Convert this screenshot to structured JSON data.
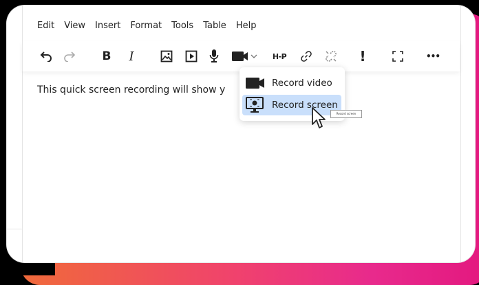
{
  "menubar": {
    "items": [
      "Edit",
      "View",
      "Insert",
      "Format",
      "Tools",
      "Table",
      "Help"
    ]
  },
  "toolbar": {
    "bold_label": "B",
    "italic_label": "I",
    "h5p_label": "H-P",
    "alert_label": "!",
    "more_label": "•••",
    "icons": [
      "undo-icon",
      "redo-icon",
      "bold-icon",
      "italic-icon",
      "image-icon",
      "media-icon",
      "microphone-icon",
      "video-camera-icon",
      "h5p-icon",
      "link-icon",
      "unlink-icon",
      "accessibility-icon",
      "fullscreen-icon",
      "more-icon"
    ]
  },
  "content": {
    "text": "This quick screen recording will show y"
  },
  "dropdown": {
    "items": [
      {
        "label": "Record video",
        "icon": "video-camera-icon",
        "highlighted": false
      },
      {
        "label": "Record screen",
        "icon": "monitor-record-icon",
        "highlighted": true
      }
    ]
  },
  "tooltip": {
    "text": "Record screen"
  },
  "colors": {
    "highlight": "#c9dffb",
    "gradient_start": "#f06a3a",
    "gradient_end": "#e3187f"
  }
}
